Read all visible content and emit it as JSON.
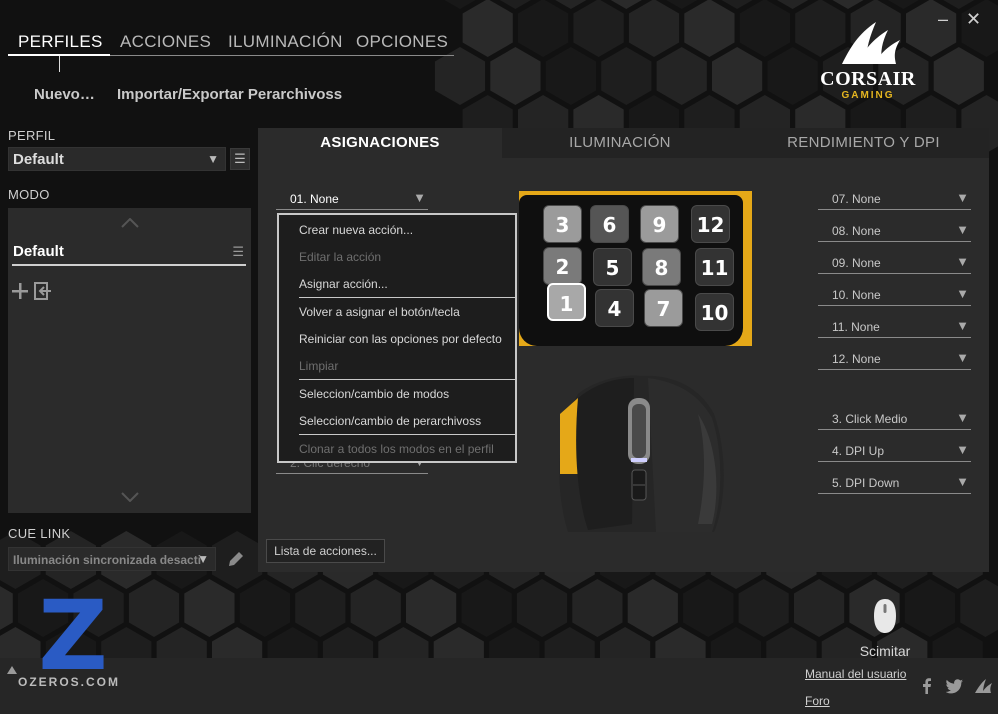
{
  "window": {
    "minimize": "–",
    "close": "✕"
  },
  "nav": {
    "tabs": [
      {
        "label": "PERFILES",
        "active": true
      },
      {
        "label": "ACCIONES"
      },
      {
        "label": "ILUMINACIÓN"
      },
      {
        "label": "OPCIONES"
      }
    ],
    "actions": {
      "new": "Nuevo…",
      "import_export": "Importar/Exportar Perarchivoss"
    }
  },
  "brand": {
    "name": "CORSAIR",
    "sub": "GAMING",
    "accent": "#e5b620"
  },
  "left": {
    "profile_label": "PERFIL",
    "profile_value": "Default",
    "mode_label": "MODO",
    "mode_item": "Default",
    "cue_link_label": "CUE LINK",
    "cue_link_value": "Iluminación sincronizada desacti"
  },
  "main": {
    "tabs": [
      {
        "label": "ASIGNACIONES",
        "active": true
      },
      {
        "label": "ILUMINACIÓN"
      },
      {
        "label": "RENDIMIENTO Y DPI"
      }
    ],
    "current_key": "01. None",
    "hidden_key": "2. Clic derecho",
    "dropdown_items": [
      {
        "label": "Crear nueva acción...",
        "enabled": true
      },
      {
        "label": "Editar la acción",
        "enabled": false
      },
      {
        "label": "Asignar acción...",
        "enabled": true
      },
      {
        "label": "Volver a asignar el botón/tecla",
        "enabled": true
      },
      {
        "label": "Reiniciar con las opciones por defecto",
        "enabled": true
      },
      {
        "label": "Limpiar",
        "enabled": false
      },
      {
        "label": "Seleccion/cambio de modos",
        "enabled": true
      },
      {
        "label": "Seleccion/cambio de perarchivoss",
        "enabled": true
      },
      {
        "label": "Clonar a todos los modos en el perfil",
        "enabled": false
      }
    ],
    "right_keys": [
      "07. None",
      "08. None",
      "09. None",
      "10. None",
      "11. None",
      "12. None"
    ],
    "mouse_keys": [
      "3. Click Medio",
      "4. DPI Up",
      "5. DPI Down"
    ],
    "action_list_button": "Lista de acciones..."
  },
  "keypad": {
    "keys": [
      "3",
      "6",
      "9",
      "12",
      "2",
      "5",
      "8",
      "11",
      "1",
      "4",
      "7",
      "10"
    ],
    "selected": "1"
  },
  "device": {
    "name": "Scimitar"
  },
  "footer": {
    "manual": "Manual del usuario",
    "forum": "Foro",
    "watermark": "OZEROS.COM",
    "watermark_letter": "Z"
  }
}
